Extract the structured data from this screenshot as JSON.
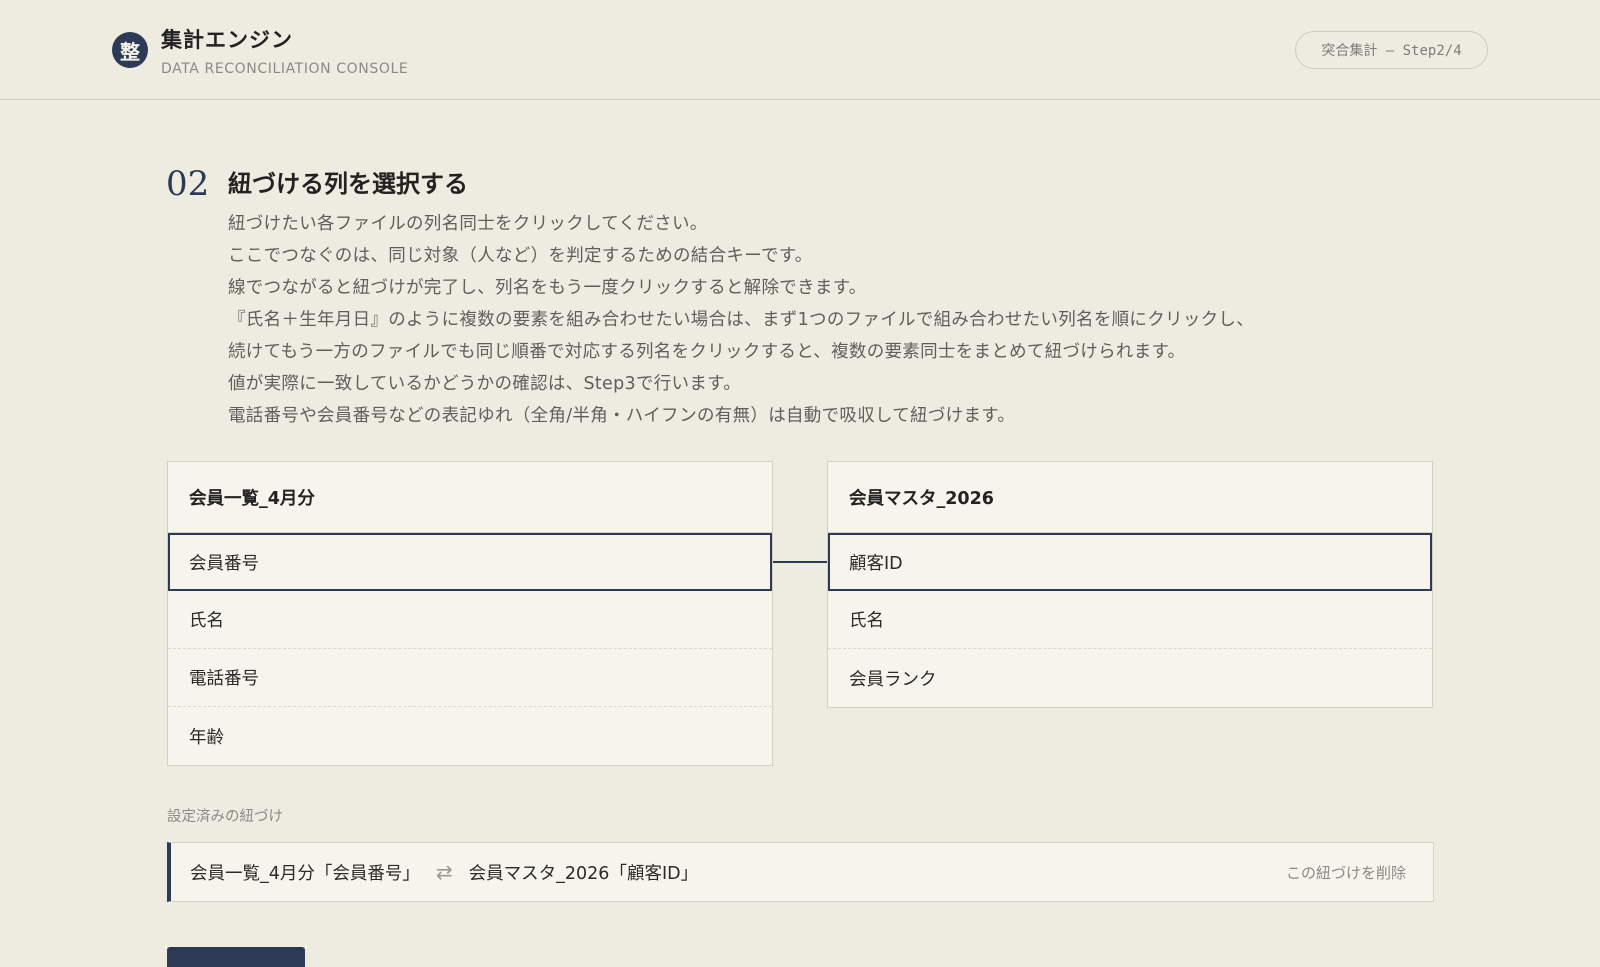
{
  "header": {
    "logo_char": "整",
    "title": "集計エンジン",
    "subtitle": "DATA RECONCILIATION CONSOLE",
    "step_pill": "突合集計 — Step2/4"
  },
  "step": {
    "number": "02",
    "title": "紐づける列を選択する",
    "instructions": [
      "紐づけたい各ファイルの列名同士をクリックしてください。",
      "ここでつなぐのは、同じ対象（人など）を判定するための結合キーです。",
      "線でつながると紐づけが完了し、列名をもう一度クリックすると解除できます。",
      "『氏名＋生年月日』のように複数の要素を組み合わせたい場合は、まず1つのファイルで組み合わせたい列名を順にクリックし、",
      "続けてもう一方のファイルでも同じ順番で対応する列名をクリックすると、複数の要素同士をまとめて紐づけられます。",
      "値が実際に一致しているかどうかの確認は、Step3で行います。",
      "電話番号や会員番号などの表記ゆれ（全角/半角・ハイフンの有無）は自動で吸収して紐づけます。"
    ]
  },
  "files": {
    "left": {
      "name": "会員一覧_4月分",
      "columns": [
        "会員番号",
        "氏名",
        "電話番号",
        "年齢"
      ]
    },
    "right": {
      "name": "会員マスタ_2026",
      "columns": [
        "顧客ID",
        "氏名",
        "会員ランク"
      ]
    }
  },
  "mappings": {
    "section_label": "設定済みの紐づけ",
    "items": [
      {
        "left": "会員一覧_4月分「会員番号」",
        "arrow": "⇄",
        "right": "会員マスタ_2026「顧客ID」",
        "delete_label": "この紐づけを削除"
      }
    ]
  },
  "colors": {
    "accent": "#2c3a55",
    "background": "#eeebe1",
    "card": "#f6f4ec"
  }
}
